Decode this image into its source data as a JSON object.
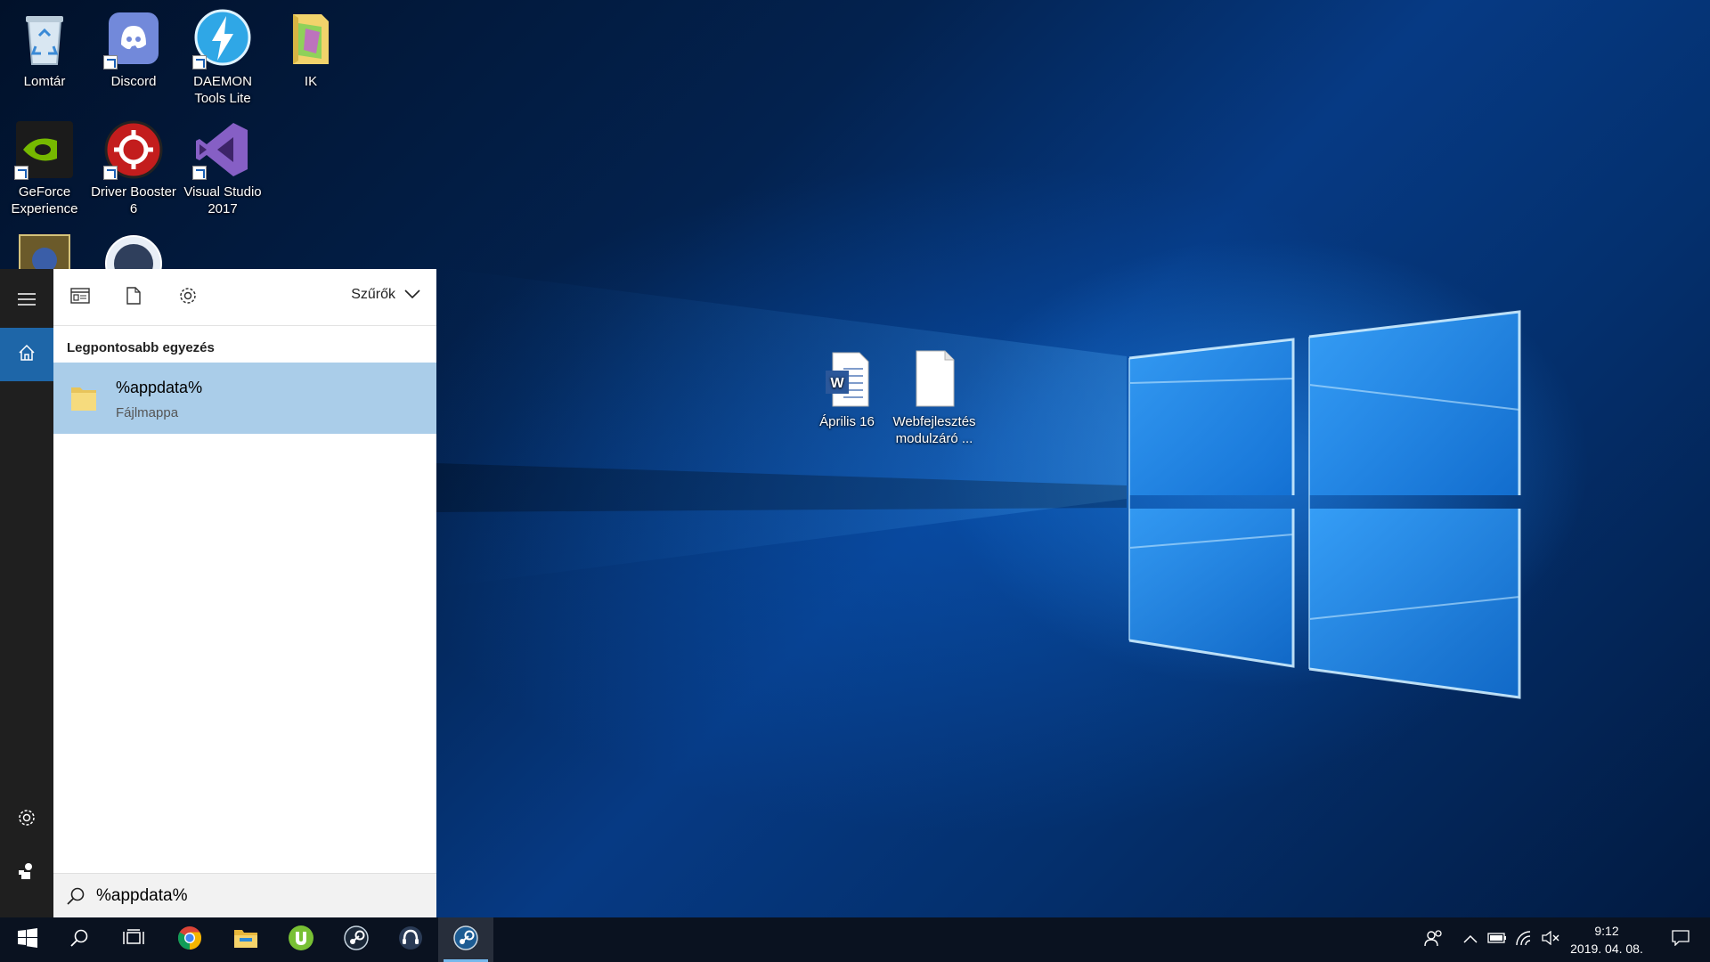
{
  "desktop": {
    "icons": [
      {
        "label": "Lomtár",
        "icon": "recycle-bin-icon"
      },
      {
        "label": "Discord",
        "icon": "discord-icon"
      },
      {
        "label": "DAEMON Tools Lite",
        "icon": "daemon-tools-icon"
      },
      {
        "label": "IK",
        "icon": "folder-icon"
      },
      {
        "label": "GeForce Experience",
        "icon": "nvidia-icon"
      },
      {
        "label": "Driver Booster 6",
        "icon": "driver-booster-icon"
      },
      {
        "label": "Visual Studio 2017",
        "icon": "visual-studio-icon"
      },
      {
        "label": "Április 16",
        "icon": "word-document-icon"
      },
      {
        "label": "Webfejlesztés modulzáró ...",
        "icon": "text-document-icon"
      }
    ]
  },
  "search_panel": {
    "rail": [
      "menu-icon",
      "home-icon",
      "settings-icon",
      "feedback-icon"
    ],
    "toolbar": {
      "tools": [
        "apps-filter-icon",
        "documents-filter-icon",
        "settings-filter-icon"
      ],
      "filters_label": "Szűrők"
    },
    "best_match_title": "Legpontosabb egyezés",
    "result": {
      "title": "%appdata%",
      "subtitle": "Fájlmappa"
    },
    "search": {
      "value": "%appdata%",
      "placeholder": ""
    }
  },
  "taskbar": {
    "apps": [
      "start-icon",
      "search-icon",
      "task-view-icon",
      "chrome-icon",
      "file-explorer-icon",
      "utorrent-icon",
      "steam-icon",
      "teamspeak-icon",
      "steam-active-icon"
    ],
    "tray": [
      "people-icon",
      "show-hidden-icons-icon",
      "battery-icon",
      "wifi-icon",
      "volume-muted-icon"
    ],
    "clock": {
      "time": "9:12",
      "date": "2019. 04. 08."
    },
    "notifications_icon": "action-center-icon"
  },
  "colors": {
    "accent": "#1e66a8",
    "selection": "#aacde9",
    "rail": "#1f1f1f",
    "taskbar": "#0a1220"
  }
}
